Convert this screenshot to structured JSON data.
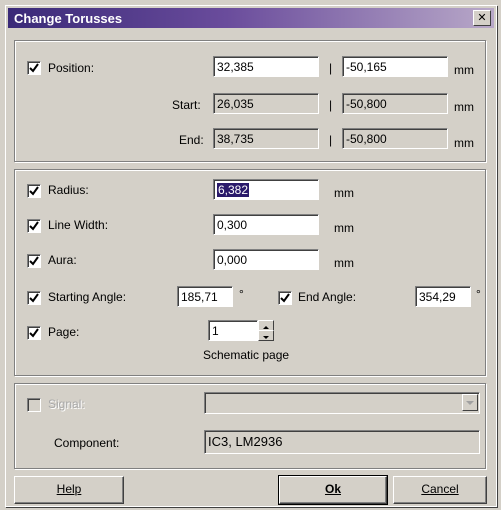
{
  "window": {
    "title": "Change Torusses",
    "close_glyph": "✕"
  },
  "position": {
    "label": "Position:",
    "x": "32,385",
    "y": "-50,165",
    "start_label": "Start:",
    "start_x": "26,035",
    "start_y": "-50,800",
    "end_label": "End:",
    "end_x": "38,735",
    "end_y": "-50,800",
    "separator": "|",
    "unit": "mm"
  },
  "props": {
    "radius_label": "Radius:",
    "radius_value": "6,382",
    "linewidth_label": "Line Width:",
    "linewidth_value": "0,300",
    "aura_label": "Aura:",
    "aura_value": "0,000",
    "unit": "mm",
    "start_angle_label": "Starting Angle:",
    "start_angle_value": "185,71",
    "end_angle_label": "End Angle:",
    "end_angle_value": "354,29",
    "degree": "°",
    "page_label": "Page:",
    "page_value": "1",
    "page_caption": "Schematic page"
  },
  "signal": {
    "label": "Signal:",
    "value": "",
    "component_label": "Component:",
    "component_value": "IC3, LM2936"
  },
  "buttons": {
    "help": "Help",
    "ok": "Ok",
    "cancel": "Cancel"
  }
}
